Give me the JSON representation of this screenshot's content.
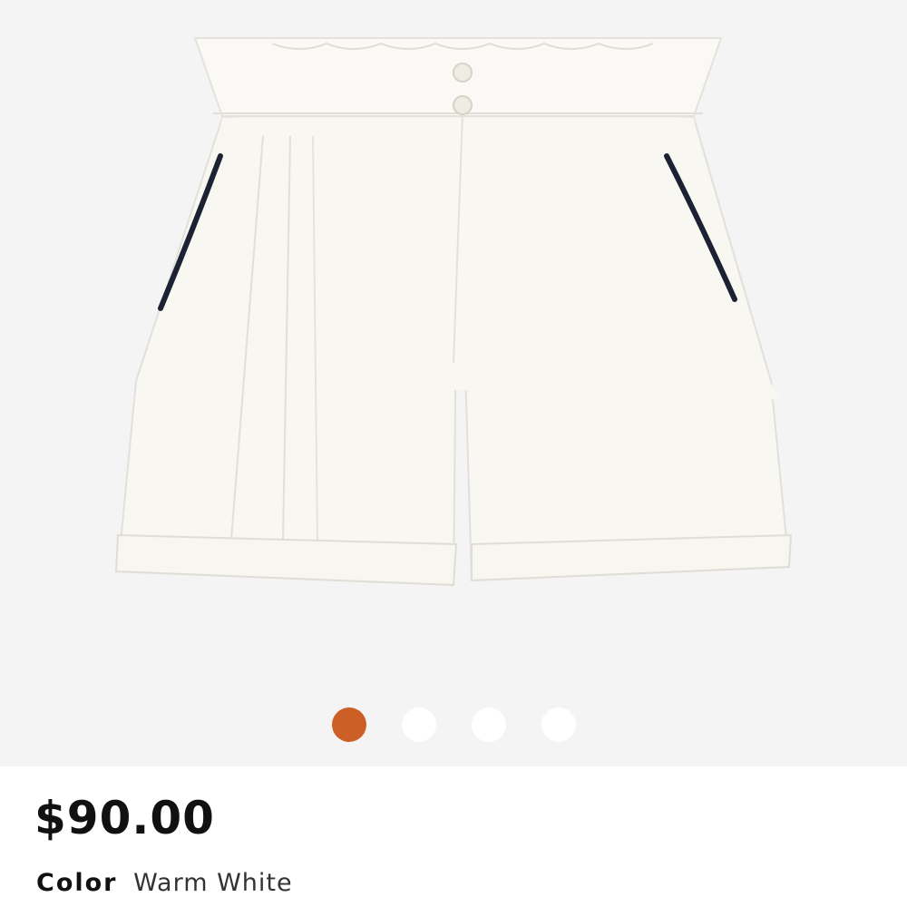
{
  "product": {
    "image_alt": "White pleated shorts",
    "price": "$90.00",
    "color_label": "Color",
    "color_value": "Warm White"
  },
  "carousel": {
    "total": 4,
    "active_index": 0
  },
  "colors": {
    "gallery_bg": "#f4f4f4",
    "active_dot": "#cc5f26",
    "inactive_dot": "#ffffff",
    "fabric": "#f7f6f0",
    "piping": "#1c2233"
  }
}
